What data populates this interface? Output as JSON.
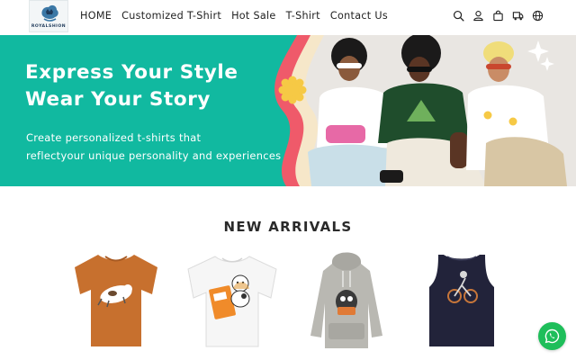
{
  "brand": {
    "logo_text": "ROYALSHION"
  },
  "nav": {
    "items": [
      {
        "label": "HOME"
      },
      {
        "label": "Customized T-Shirt"
      },
      {
        "label": "Hot Sale"
      },
      {
        "label": "T-Shirt"
      },
      {
        "label": "Contact Us"
      }
    ]
  },
  "header_icons": [
    "search-icon",
    "account-icon",
    "cart-icon",
    "truck-icon",
    "globe-icon"
  ],
  "banner": {
    "headline_line1": "Express Your Style",
    "headline_line2": "Wear Your Story",
    "sub_line1": "Create personalized t-shirts that",
    "sub_line2": "reflectyour unique personality and experiences",
    "colors": {
      "background": "#11b9a0",
      "wave_red": "#ef5a6a",
      "wave_cream": "#f6e7c9",
      "accent_yellow": "#f6c945"
    }
  },
  "new_arrivals": {
    "title": "NEW ARRIVALS",
    "products": [
      {
        "name": "orange-tshirt",
        "color": "#c7702e"
      },
      {
        "name": "white-tshirt",
        "color": "#f5f5f5"
      },
      {
        "name": "grey-hoodie",
        "color": "#b9b8b2"
      },
      {
        "name": "navy-tank-top",
        "color": "#22233a"
      }
    ]
  },
  "whatsapp": {
    "icon": "whatsapp-icon",
    "color": "#1ebe5a"
  }
}
